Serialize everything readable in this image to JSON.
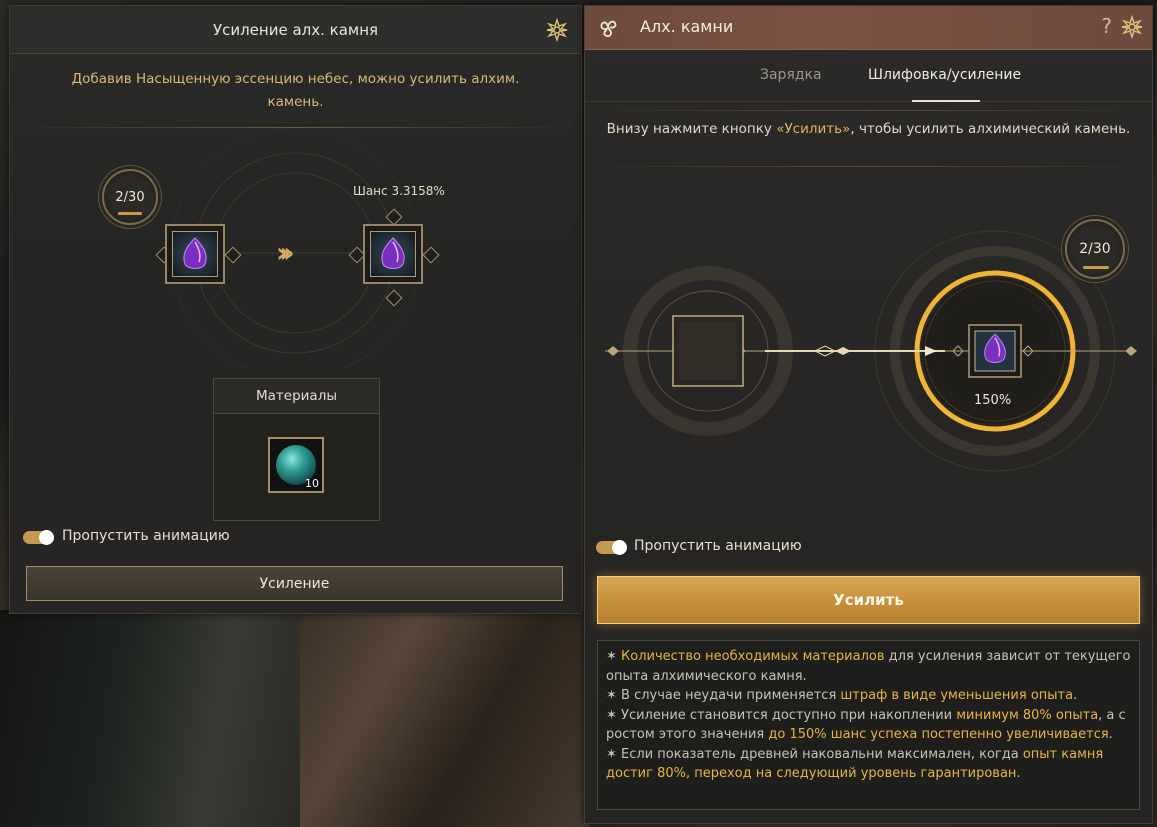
{
  "left_panel": {
    "title": "Усиление алх. камня",
    "notice": "Добавив Насыщенную эссенцию небес, можно усилить алхим. камень.",
    "level_badge": "2/30",
    "chance_label": "Шанс 3.3158%",
    "materials_title": "Материалы",
    "material_count": "10",
    "skip_animation_label": "Пропустить анимацию",
    "enhance_button": "Усиление"
  },
  "right_panel": {
    "title": "Алх. камни",
    "help_icon": "?",
    "tabs": [
      {
        "label": "Зарядка",
        "active": false
      },
      {
        "label": "Шлифовка/усиление",
        "active": true
      }
    ],
    "notice_pre": "Внизу нажмите кнопку ",
    "notice_highlight": "«Усилить»",
    "notice_post": ", чтобы усилить алхимический камень.",
    "level_badge": "2/30",
    "percent": "150%",
    "skip_animation_label": "Пропустить анимацию",
    "enhance_button": "Усилить",
    "info": {
      "l1_pre": "✶ ",
      "l1_hl": "Количество необходимых материалов",
      "l1_post": " для усиления зависит от текущего опыта алхимического камня.",
      "l2_pre": "✶ В случае неудачи применяется ",
      "l2_hl": "штраф в виде уменьшения опыта",
      "l2_post": ".",
      "l3_pre": "✶ Усиление становится доступно при накоплении ",
      "l3_hl1": "минимум 80% опыта",
      "l3_mid": ", а с ростом этого значения ",
      "l3_hl2": "до 150% шанс успеха постепенно увеличивается",
      "l3_post": ".",
      "l4_pre": "✶ Если показатель древней наковальни максимален, когда ",
      "l4_hl": "опыт камня достиг 80%, переход на следующий уровень гарантирован",
      "l4_post": "."
    }
  },
  "colors": {
    "accent_gold": "#e6b53d",
    "header_brown": "#7b5244",
    "button_gold": "#d8a855"
  }
}
